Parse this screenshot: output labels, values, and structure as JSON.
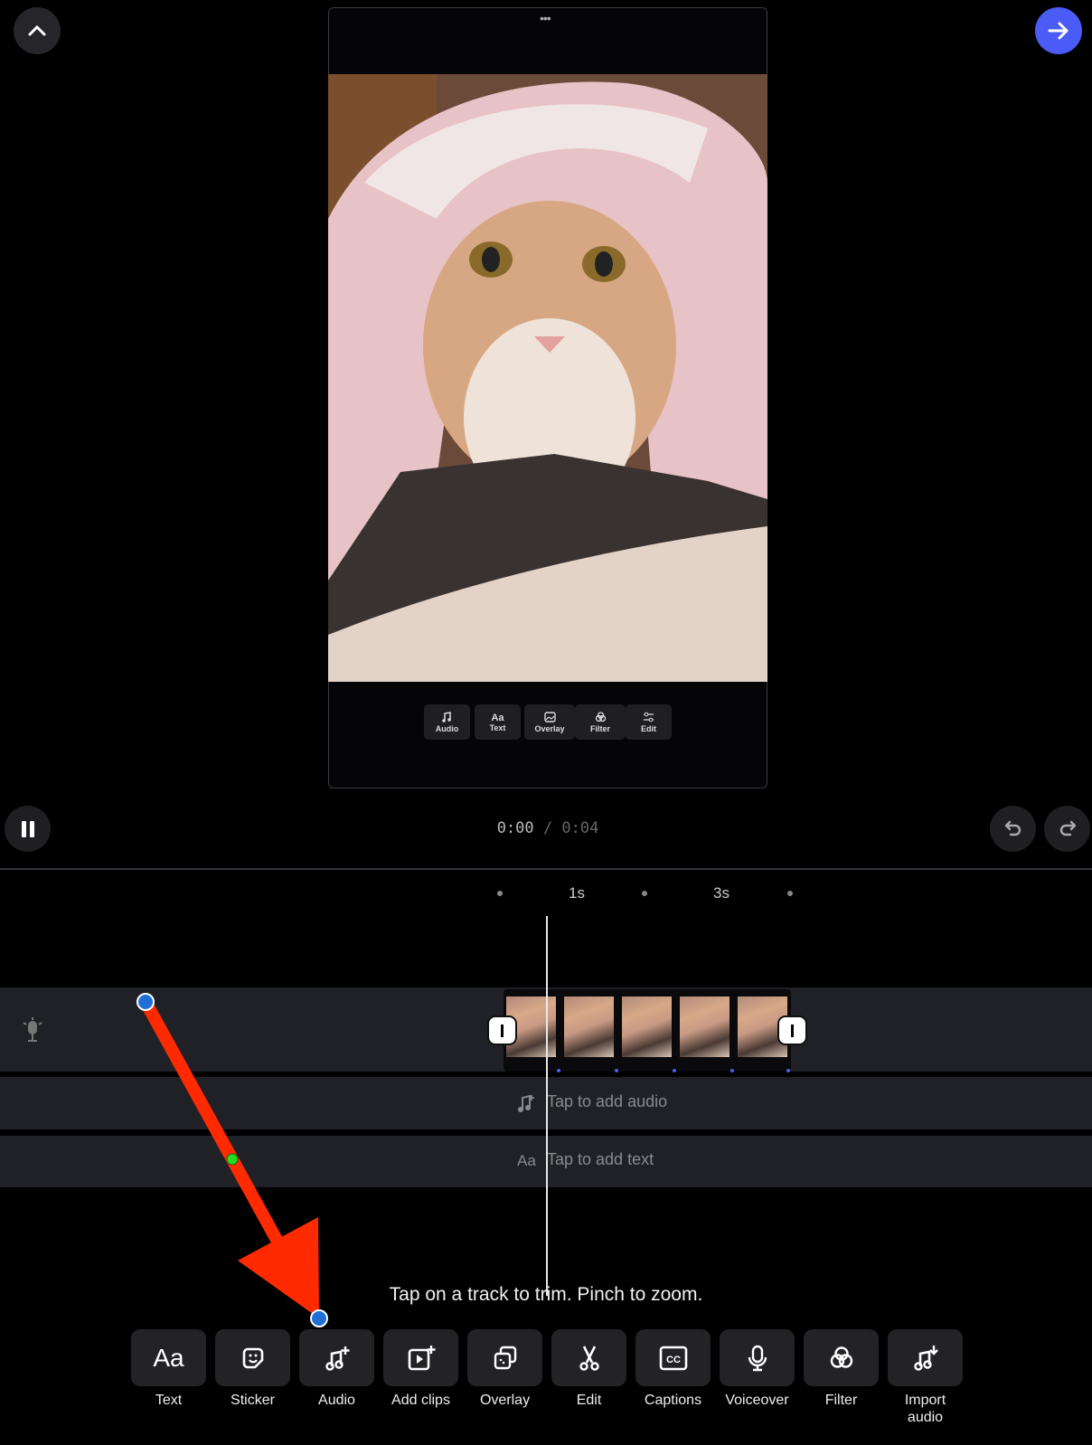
{
  "header": {
    "collapse_icon": "chevron-up-icon",
    "next_icon": "arrow-right-icon",
    "accent": "#4a5cf5"
  },
  "preview": {
    "more_label": "•••",
    "mini_toolbar": [
      {
        "label": "Audio",
        "icon": "music-plus-icon"
      },
      {
        "label": "Text",
        "icon": "text-aa-icon"
      },
      {
        "label": "Overlay",
        "icon": "image-icon"
      },
      {
        "label": "Filter",
        "icon": "filter-icon"
      },
      {
        "label": "Edit",
        "icon": "sliders-icon"
      }
    ]
  },
  "playback": {
    "current": "0:00",
    "separator": " / ",
    "total": "0:04"
  },
  "ruler": {
    "labels": [
      "1s",
      "3s"
    ]
  },
  "tracks": {
    "audio_placeholder": "Tap to add audio",
    "text_placeholder": "Tap to add text",
    "clip_count": 5
  },
  "hint": "Tap on a track to trim. Pinch to zoom.",
  "toolbar": [
    {
      "label": "Text",
      "icon": "text-aa-icon"
    },
    {
      "label": "Sticker",
      "icon": "sticker-icon"
    },
    {
      "label": "Audio",
      "icon": "music-plus-icon"
    },
    {
      "label": "Add clips",
      "icon": "add-clip-icon"
    },
    {
      "label": "Overlay",
      "icon": "overlay-icon"
    },
    {
      "label": "Edit",
      "icon": "scissors-icon"
    },
    {
      "label": "Captions",
      "icon": "cc-icon"
    },
    {
      "label": "Voiceover",
      "icon": "microphone-icon"
    },
    {
      "label": "Filter",
      "icon": "filter-icon"
    },
    {
      "label": "Import audio",
      "icon": "music-import-icon"
    }
  ],
  "annotation": {
    "color": "#ff2a00"
  }
}
